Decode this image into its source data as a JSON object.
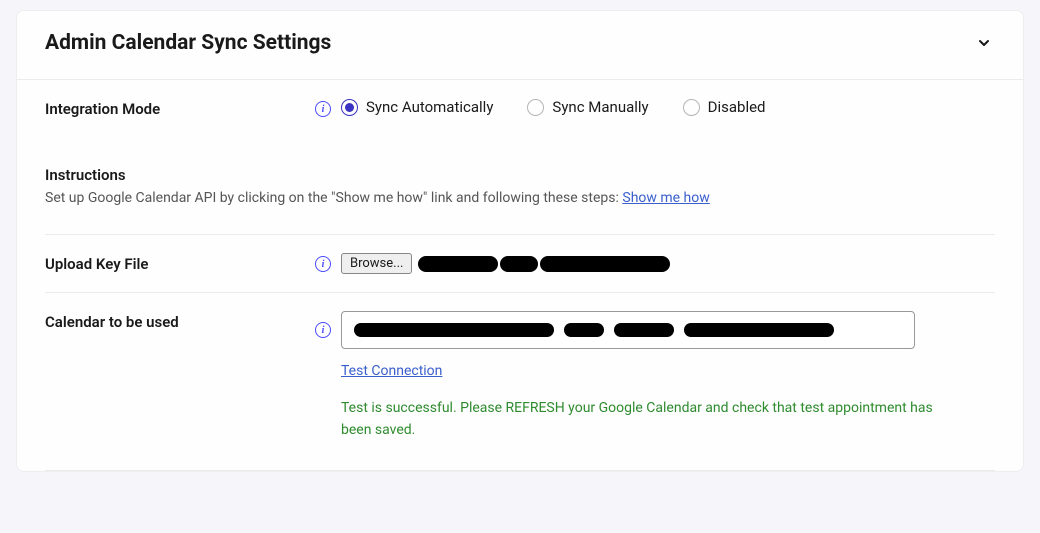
{
  "card": {
    "title": "Admin Calendar Sync Settings"
  },
  "integration_mode": {
    "label": "Integration Mode",
    "options": {
      "auto": "Sync Automatically",
      "manual": "Sync Manually",
      "disabled": "Disabled"
    },
    "selected": "auto"
  },
  "instructions": {
    "title": "Instructions",
    "body_prefix": "Set up Google Calendar API by clicking on the \"Show me how\" link and following these steps: ",
    "link_text": "Show me how"
  },
  "upload_key": {
    "label": "Upload Key File",
    "browse_label": "Browse..."
  },
  "calendar_used": {
    "label": "Calendar to be used",
    "test_link": "Test Connection",
    "success_message": "Test is successful. Please REFRESH your Google Calendar and check that test appointment has been saved."
  }
}
